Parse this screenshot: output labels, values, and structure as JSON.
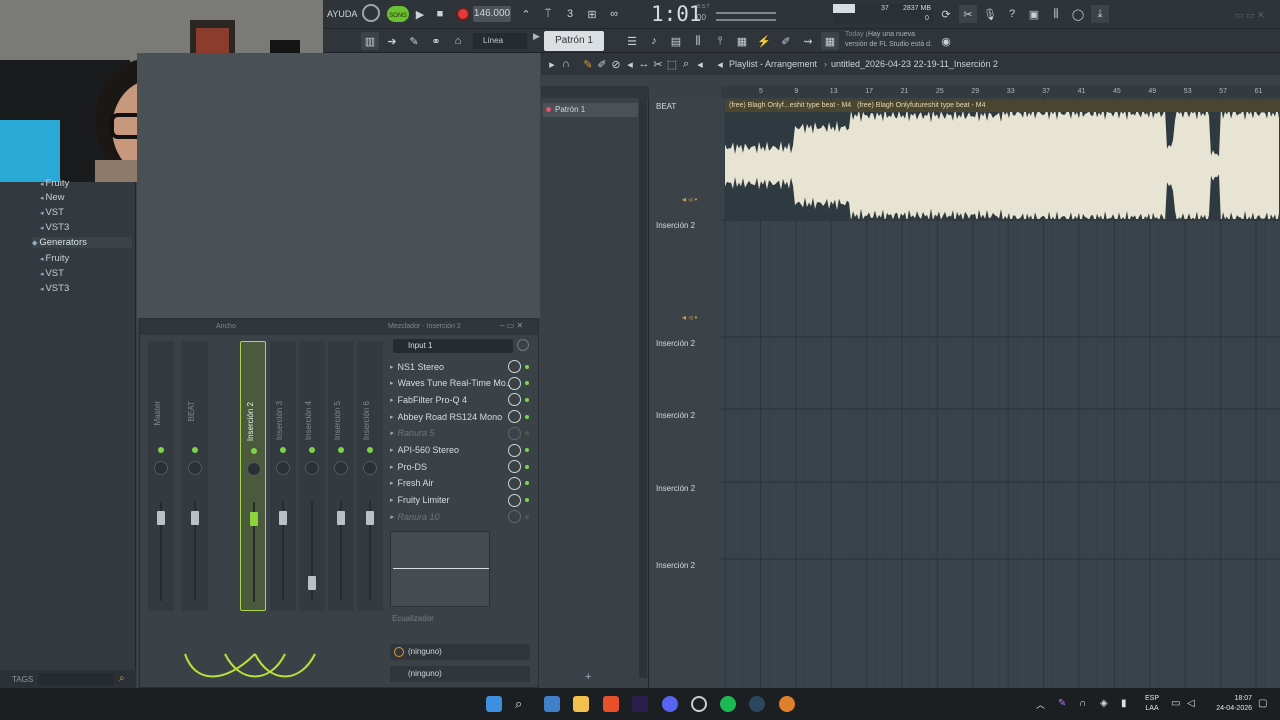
{
  "app": {
    "menu_help": "AYUDA",
    "song_mode": "SONG",
    "tempo": "146.000",
    "time": "1:01",
    "time_sub": "00",
    "bst": "B:S:T",
    "cpu": "37",
    "mem": "2837 MB",
    "mem2": "0",
    "snap": "Línea",
    "pattern": "Patrón 1",
    "news_label": "Today",
    "news_text": "¡Hay una nueva versión de FL Studio está d."
  },
  "browser": {
    "items": [
      {
        "label": "Fruity",
        "kind": "item"
      },
      {
        "label": "New",
        "kind": "item"
      },
      {
        "label": "VST",
        "kind": "item"
      },
      {
        "label": "VST3",
        "kind": "item"
      },
      {
        "label": "Generators",
        "kind": "cat"
      },
      {
        "label": "Fruity",
        "kind": "item"
      },
      {
        "label": "VST",
        "kind": "item"
      },
      {
        "label": "VST3",
        "kind": "item"
      }
    ],
    "tags_label": "TAGS"
  },
  "mixer": {
    "width_label": "Ancho",
    "panel_title": "Mezclador - Inserción 2",
    "input": "Input 1",
    "strips": [
      "Master",
      "BEAT",
      "Inserción 2",
      "Inserción 3",
      "Inserción 4",
      "Inserción 5",
      "Inserción 6"
    ],
    "slots": [
      {
        "label": "NS1 Stereo",
        "dim": false
      },
      {
        "label": "Waves Tune Real-Time Mo...",
        "dim": false
      },
      {
        "label": "FabFilter Pro-Q 4",
        "dim": false
      },
      {
        "label": "Abbey Road RS124 Mono",
        "dim": false
      },
      {
        "label": "Ranura 5",
        "dim": true
      },
      {
        "label": "API-560 Stereo",
        "dim": false
      },
      {
        "label": "Pro-DS",
        "dim": false
      },
      {
        "label": "Fresh Air",
        "dim": false
      },
      {
        "label": "Fruity Limiter",
        "dim": false
      },
      {
        "label": "Ranura 10",
        "dim": true
      }
    ],
    "eq_label": "Ecualizador",
    "send1": "(ninguno)",
    "send2": "(ninguno)"
  },
  "playlist": {
    "title": "Playlist - Arrangement",
    "breadcrumb": "untitled_2026-04-23 22-19-11_Inserción 2",
    "pattern_item": "Patrón 1",
    "tracks": [
      "BEAT",
      "Inserción 2",
      "Inserción 2",
      "Inserción 2",
      "Inserción 2",
      "Inserción 2"
    ],
    "clip_label": "(free) Blagh  Onlyf...eshit type beat - M4",
    "clip_label2": "(free) Blagh  Onlyfutureshit type beat - M4",
    "ruler": [
      "5",
      "9",
      "13",
      "17",
      "21",
      "25",
      "29",
      "33",
      "37",
      "41",
      "45",
      "49",
      "53",
      "57",
      "61"
    ]
  },
  "taskbar": {
    "lang1": "ESP",
    "lang2": "LAA",
    "clock": "18:07",
    "date": "24-04-2026"
  }
}
